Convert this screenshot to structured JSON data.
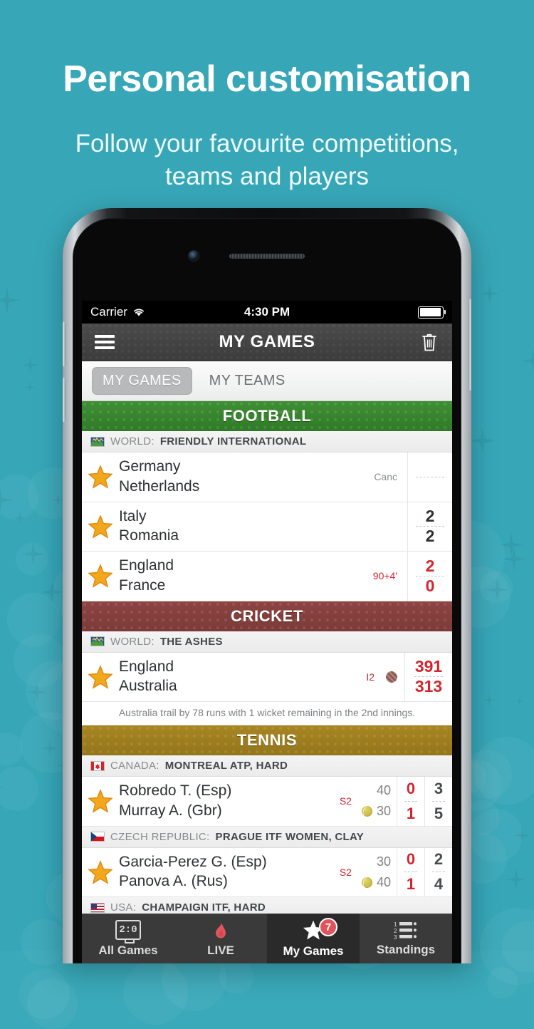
{
  "promo": {
    "headline": "Personal customisation",
    "subhead_line1": "Follow your favourite competitions,",
    "subhead_line2": "teams and players"
  },
  "colors": {
    "background": "#37a7b8",
    "football": "#3f8f35",
    "cricket": "#8c4441",
    "tennis": "#a78521",
    "live_red": "#d22630",
    "badge_red": "#e0555d"
  },
  "status_bar": {
    "carrier": "Carrier",
    "wifi_icon": "wifi-icon",
    "time": "4:30 PM",
    "battery_icon": "battery-full-icon"
  },
  "navbar": {
    "menu_icon": "hamburger-menu-icon",
    "title": "MY GAMES",
    "delete_icon": "trash-icon"
  },
  "segmented": {
    "tabs": [
      {
        "label": "MY GAMES",
        "active": true
      },
      {
        "label": "MY TEAMS",
        "active": false
      }
    ]
  },
  "sections": [
    {
      "sport": "FOOTBALL",
      "competitions": [
        {
          "flag": "world-flag-icon",
          "country": "WORLD:",
          "name": "FRIENDLY INTERNATIONAL",
          "matches": [
            {
              "star": "star-icon",
              "home": "Germany",
              "away": "Netherlands",
              "status": "Canc",
              "status_live": false,
              "home_score": "",
              "away_score": "",
              "score_dim": true
            },
            {
              "star": "star-icon",
              "home": "Italy",
              "away": "Romania",
              "status": "",
              "status_live": false,
              "home_score": "2",
              "away_score": "2",
              "score_dim": false
            },
            {
              "star": "star-icon",
              "home": "England",
              "away": "France",
              "status": "90+4'",
              "status_live": true,
              "home_score": "2",
              "away_score": "0",
              "score_dim": false,
              "score_red": true
            }
          ]
        }
      ]
    },
    {
      "sport": "CRICKET",
      "competitions": [
        {
          "flag": "world-flag-icon",
          "country": "WORLD:",
          "name": "THE ASHES",
          "matches": [
            {
              "star": "star-icon",
              "home": "England",
              "away": "Australia",
              "status": "I2",
              "status_live": true,
              "serve_icon": "cricket-ball-icon",
              "home_score": "391",
              "away_score": "313",
              "score_red": true
            }
          ],
          "note": "Australia trail by 78 runs with 1 wicket remaining in the 2nd innings."
        }
      ]
    },
    {
      "sport": "TENNIS",
      "competitions": [
        {
          "flag": "canada-flag-icon",
          "country": "CANADA:",
          "name": "MONTREAL ATP, HARD",
          "matches": [
            {
              "star": "star-icon",
              "home": "Robredo T. (Esp)",
              "away": "Murray A. (Gbr)",
              "status": "S2",
              "status_live": true,
              "home_points": "40",
              "away_points": "30",
              "serve_icon": "tennis-ball-icon",
              "serve_on": "away",
              "home_games": "0",
              "away_games": "1",
              "home_sets": "3",
              "away_sets": "5"
            }
          ]
        },
        {
          "flag": "czech-flag-icon",
          "country": "CZECH REPUBLIC:",
          "name": "PRAGUE ITF WOMEN, CLAY",
          "matches": [
            {
              "star": "star-icon",
              "home": "Garcia-Perez G. (Esp)",
              "away": "Panova A. (Rus)",
              "status": "S2",
              "status_live": true,
              "home_points": "30",
              "away_points": "40",
              "serve_icon": "tennis-ball-icon",
              "serve_on": "away",
              "home_games": "0",
              "away_games": "1",
              "home_sets": "2",
              "away_sets": "4"
            }
          ]
        },
        {
          "flag": "usa-flag-icon",
          "country": "USA:",
          "name": "CHAMPAIGN ITF, HARD",
          "matches": []
        }
      ]
    }
  ],
  "tabbar": {
    "items": [
      {
        "label": "All Games",
        "icon": "scoreboard-icon",
        "icon_text": "2:0",
        "active": false,
        "badge": ""
      },
      {
        "label": "LIVE",
        "icon": "flame-icon",
        "active": false,
        "badge": ""
      },
      {
        "label": "My Games",
        "icon": "star-icon",
        "active": true,
        "badge": "7"
      },
      {
        "label": "Standings",
        "icon": "standings-list-icon",
        "active": false,
        "badge": ""
      }
    ]
  }
}
